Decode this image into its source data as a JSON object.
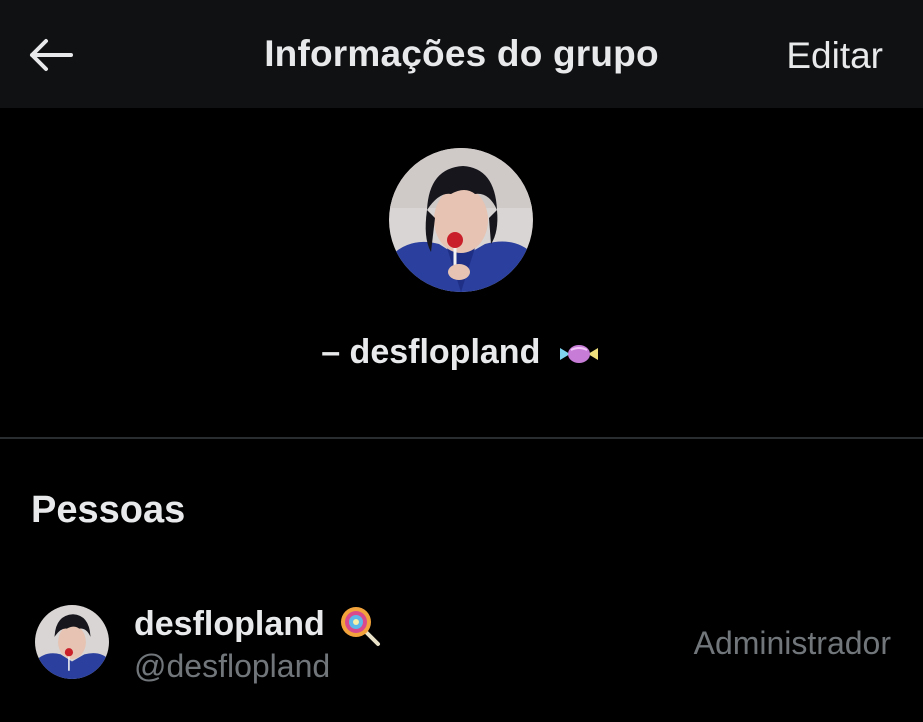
{
  "header": {
    "back_icon": "arrow-left-icon",
    "title": "Informações do grupo",
    "edit_label": "Editar"
  },
  "group": {
    "name": "– desflopland",
    "name_emoji": "candy-icon",
    "avatar": "group-avatar-photo"
  },
  "people": {
    "section_title": "Pessoas",
    "members": [
      {
        "name": "desflopland",
        "name_emoji": "lollipop-icon",
        "handle": "@desflopland",
        "role": "Administrador"
      }
    ]
  },
  "colors": {
    "background": "#000000",
    "header_bg": "#101112",
    "primary_text": "#e7e9ea",
    "secondary_text": "#71767b",
    "divider": "#2a2d30"
  }
}
